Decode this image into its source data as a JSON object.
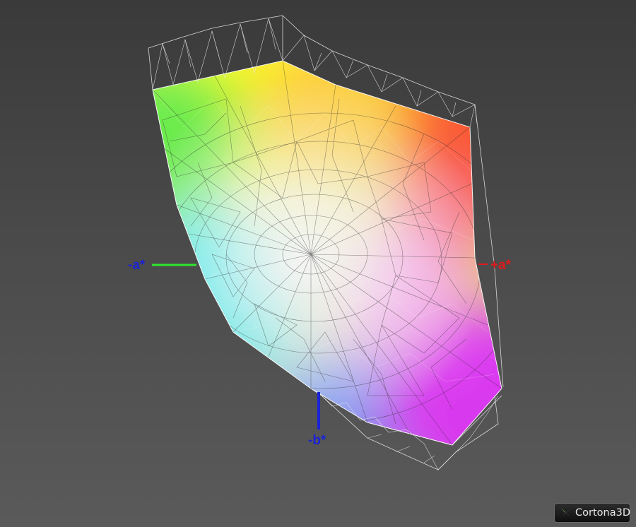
{
  "axes": {
    "neg_a": {
      "label": "-a*",
      "label_color": "#1a23d6",
      "line_color": "#2ee82e"
    },
    "pos_a": {
      "label": "+a*",
      "label_color": "#e01a1a",
      "line_color": "#e01a1a"
    },
    "neg_b": {
      "label": "-b*",
      "label_color": "#1a23d6",
      "line_color": "#1a23d6"
    }
  },
  "gamut_colors": {
    "yellow": "#ffff20",
    "green": "#6ef050",
    "cyan": "#28f0f0",
    "blue": "#7e9cff",
    "magenta": "#e83cff",
    "red": "#ff5a30",
    "white": "#ffffff"
  },
  "wireframe_color": "#e6e6e6",
  "branding": {
    "logo_text": "Cortona3D",
    "logo_icon": "cortona3d-logo-icon"
  }
}
